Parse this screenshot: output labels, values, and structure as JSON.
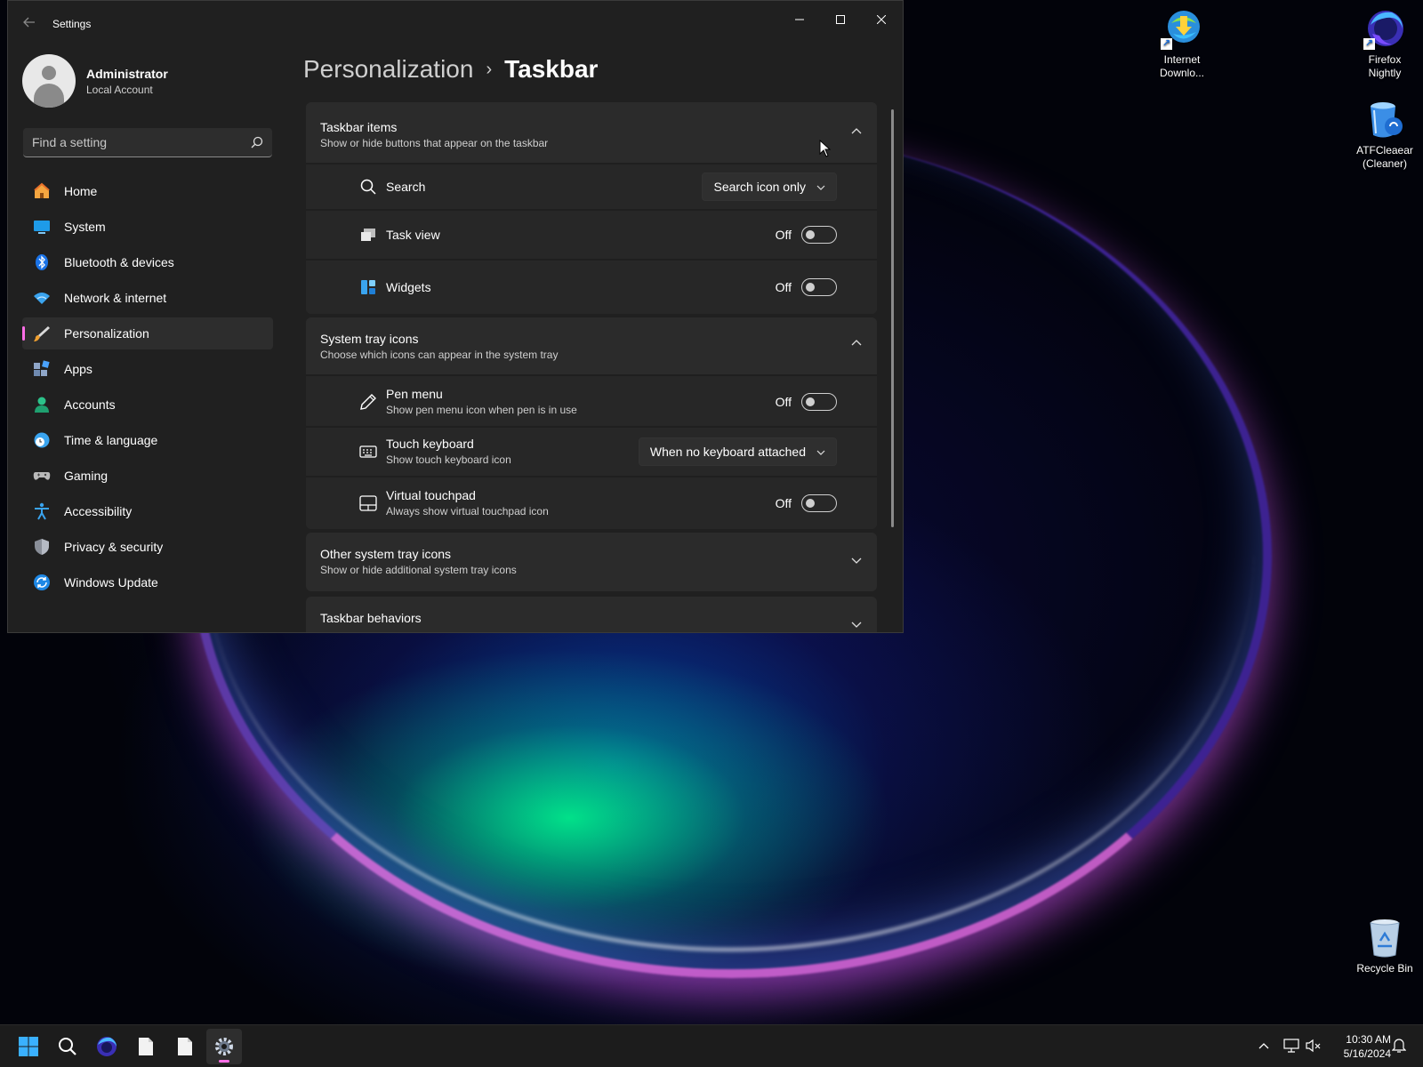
{
  "window": {
    "title": "Settings"
  },
  "user": {
    "name": "Administrator",
    "account_type": "Local Account"
  },
  "search": {
    "placeholder": "Find a setting"
  },
  "sidebar": {
    "items": [
      {
        "label": "Home",
        "icon": "home-icon"
      },
      {
        "label": "System",
        "icon": "system-icon"
      },
      {
        "label": "Bluetooth & devices",
        "icon": "bluetooth-icon"
      },
      {
        "label": "Network & internet",
        "icon": "network-icon"
      },
      {
        "label": "Personalization",
        "icon": "personalization-icon",
        "active": true
      },
      {
        "label": "Apps",
        "icon": "apps-icon"
      },
      {
        "label": "Accounts",
        "icon": "accounts-icon"
      },
      {
        "label": "Time & language",
        "icon": "time-language-icon"
      },
      {
        "label": "Gaming",
        "icon": "gaming-icon"
      },
      {
        "label": "Accessibility",
        "icon": "accessibility-icon"
      },
      {
        "label": "Privacy & security",
        "icon": "privacy-shield-icon"
      },
      {
        "label": "Windows Update",
        "icon": "windows-update-icon"
      }
    ]
  },
  "breadcrumb": {
    "parent": "Personalization",
    "separator": "›",
    "current": "Taskbar"
  },
  "sections": {
    "taskbar_items": {
      "title": "Taskbar items",
      "subtitle": "Show or hide buttons that appear on the taskbar",
      "expanded": true,
      "rows": {
        "search": {
          "title": "Search",
          "control": "dropdown",
          "value": "Search icon only"
        },
        "task_view": {
          "title": "Task view",
          "control": "toggle",
          "state": "Off"
        },
        "widgets": {
          "title": "Widgets",
          "control": "toggle",
          "state": "Off"
        }
      }
    },
    "system_tray": {
      "title": "System tray icons",
      "subtitle": "Choose which icons can appear in the system tray",
      "expanded": true,
      "rows": {
        "pen_menu": {
          "title": "Pen menu",
          "subtitle": "Show pen menu icon when pen is in use",
          "control": "toggle",
          "state": "Off"
        },
        "touch_keyboard": {
          "title": "Touch keyboard",
          "subtitle": "Show touch keyboard icon",
          "control": "dropdown",
          "value": "When no keyboard attached"
        },
        "virtual_touchpad": {
          "title": "Virtual touchpad",
          "subtitle": "Always show virtual touchpad icon",
          "control": "toggle",
          "state": "Off"
        }
      }
    },
    "other_tray": {
      "title": "Other system tray icons",
      "subtitle": "Show or hide additional system tray icons",
      "expanded": false
    },
    "behaviors": {
      "title": "Taskbar behaviors",
      "expanded": false
    }
  },
  "desktop_icons": [
    {
      "label": "Internet Downlo...",
      "icon": "internet-download-manager-icon"
    },
    {
      "label": "Firefox Nightly",
      "icon": "firefox-nightly-icon"
    },
    {
      "label": "ATFCleaear (Cleaner)",
      "icon": "atf-cleaner-icon"
    },
    {
      "label": "Recycle Bin",
      "icon": "recycle-bin-icon"
    }
  ],
  "taskbar": {
    "time": "10:30 AM",
    "date": "5/16/2024"
  },
  "colors": {
    "accent": "#ff6ee7",
    "window_bg": "#202020",
    "card_bg": "#2b2b2b",
    "taskbar_bg": "#1c1c1c"
  }
}
